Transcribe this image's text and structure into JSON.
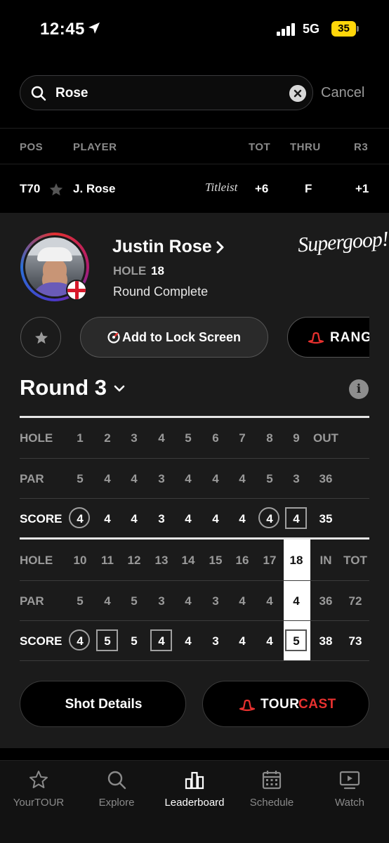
{
  "status_bar": {
    "time": "12:45",
    "network": "5G",
    "battery": "35",
    "battery_color": "#ffd60a"
  },
  "search": {
    "query": "Rose",
    "cancel_label": "Cancel"
  },
  "leaderboard": {
    "columns": [
      "POS",
      "PLAYER",
      "TOT",
      "THRU",
      "R3"
    ],
    "row": {
      "pos": "T70",
      "player": "J. Rose",
      "sponsor": "Titleist",
      "tot": "+6",
      "thru": "F",
      "r3": "+1"
    }
  },
  "player_card": {
    "name": "Justin Rose",
    "hole_label": "HOLE",
    "hole_value": "18",
    "status": "Round Complete",
    "sponsor": "Supergoop!",
    "lock_screen_label": "Add to Lock Screen",
    "range_label": "RANG"
  },
  "round": {
    "title": "Round 3",
    "info_icon": "i",
    "front": {
      "hole_label": "HOLE",
      "par_label": "PAR",
      "score_label": "SCORE",
      "holes": [
        "1",
        "2",
        "3",
        "4",
        "5",
        "6",
        "7",
        "8",
        "9",
        "OUT"
      ],
      "par": [
        "5",
        "4",
        "4",
        "3",
        "4",
        "4",
        "4",
        "5",
        "3",
        "36"
      ],
      "score": [
        "4",
        "4",
        "4",
        "3",
        "4",
        "4",
        "4",
        "4",
        "4",
        "35"
      ],
      "score_marks": [
        "birdie",
        "",
        "",
        "",
        "",
        "",
        "",
        "birdie",
        "bogey",
        ""
      ]
    },
    "back": {
      "hole_label": "HOLE",
      "par_label": "PAR",
      "score_label": "SCORE",
      "holes": [
        "10",
        "11",
        "12",
        "13",
        "14",
        "15",
        "16",
        "17",
        "18",
        "IN",
        "TOT"
      ],
      "par": [
        "5",
        "4",
        "5",
        "3",
        "4",
        "3",
        "4",
        "4",
        "4",
        "36",
        "72"
      ],
      "score": [
        "4",
        "5",
        "5",
        "4",
        "4",
        "3",
        "4",
        "4",
        "5",
        "38",
        "73"
      ],
      "score_marks": [
        "birdie",
        "bogey",
        "",
        "bogey",
        "",
        "",
        "",
        "",
        "bogey",
        "",
        ""
      ]
    }
  },
  "actions": {
    "shot_details": "Shot Details",
    "tourcast_a": "TOUR",
    "tourcast_b": "CAST",
    "accent": "#e8312f"
  },
  "tabs": [
    {
      "label": "YourTOUR",
      "icon": "star-icon"
    },
    {
      "label": "Explore",
      "icon": "search-icon"
    },
    {
      "label": "Leaderboard",
      "icon": "bar-chart-icon"
    },
    {
      "label": "Schedule",
      "icon": "calendar-icon"
    },
    {
      "label": "Watch",
      "icon": "play-screen-icon"
    }
  ]
}
